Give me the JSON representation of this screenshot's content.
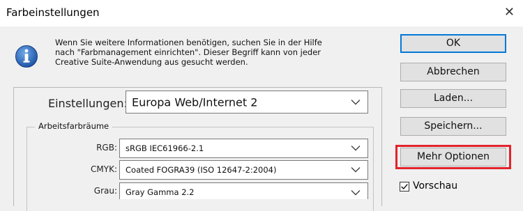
{
  "window": {
    "title": "Farbeinstellungen",
    "close_glyph": "✕"
  },
  "info": {
    "icon": "info-icon",
    "text_line1": "Wenn Sie weitere Informationen benötigen, suchen Sie in der Hilfe",
    "text_line2": "nach \"Farbmanagement einrichten\". Dieser Begriff kann von jeder",
    "text_line3": "Creative Suite-Anwendung aus gesucht werden."
  },
  "settings": {
    "label": "Einstellungen:",
    "value": "Europa Web/Internet 2"
  },
  "working_spaces": {
    "title": "Arbeitsfarbräume",
    "rows": [
      {
        "label": "RGB:",
        "value": "sRGB IEC61966-2.1"
      },
      {
        "label": "CMYK:",
        "value": "Coated FOGRA39 (ISO 12647-2:2004)"
      },
      {
        "label": "Grau:",
        "value": "Gray Gamma 2.2"
      }
    ]
  },
  "buttons": {
    "ok": "OK",
    "cancel": "Abbrechen",
    "load": "Laden...",
    "save": "Speichern...",
    "more_options": "Mehr Optionen"
  },
  "preview": {
    "label": "Vorschau",
    "checked": true,
    "check_glyph": "✓"
  },
  "colors": {
    "highlight": "#e3222b",
    "default_button_border": "#0078d7",
    "info_icon": "#2a64b8"
  }
}
